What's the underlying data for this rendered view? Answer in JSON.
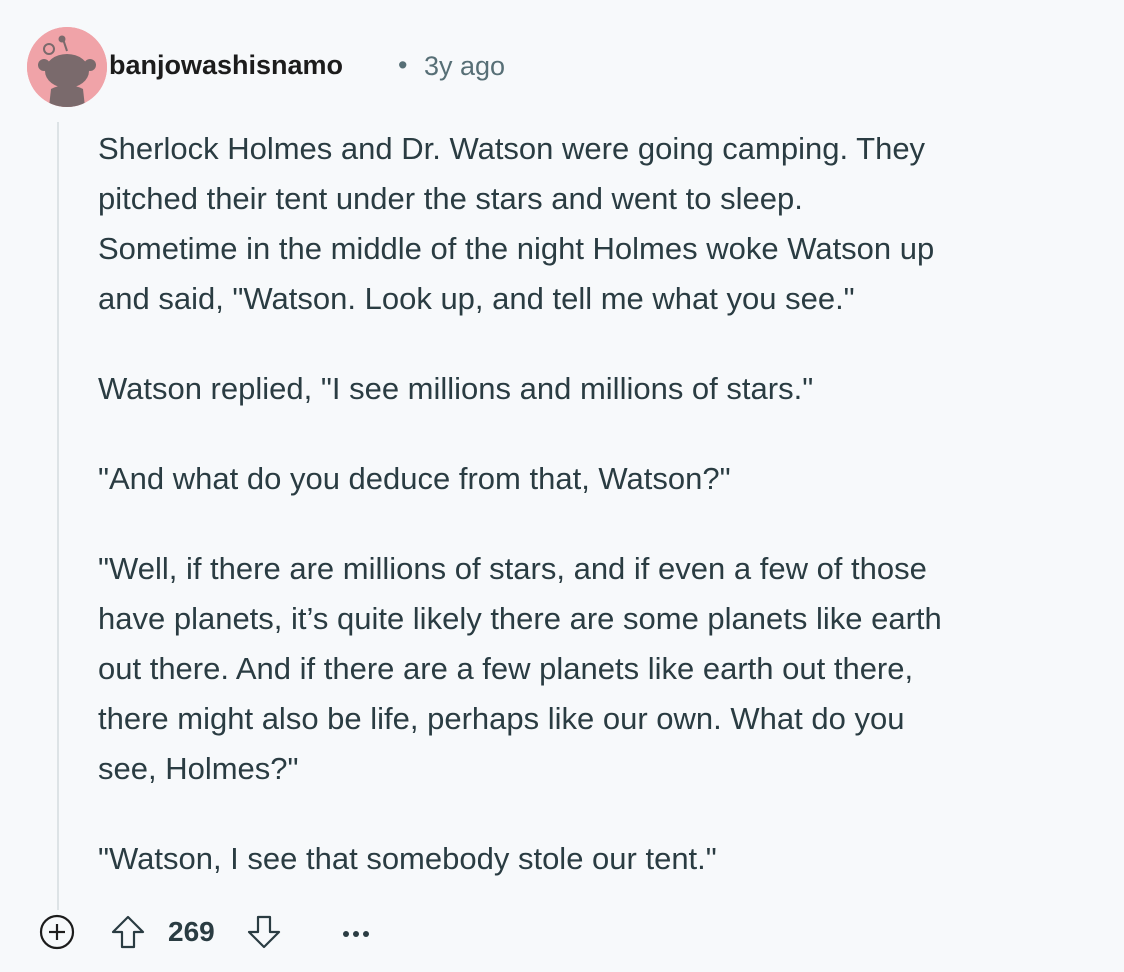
{
  "comment": {
    "author": "banjowashisnamo",
    "separator": "•",
    "age": "3y ago",
    "paragraphs": [
      "Sherlock Holmes and Dr. Watson were going camping. They\npitched their tent under the stars and went to sleep.\nSometime in the middle of the night Holmes woke Watson up\nand said, \"Watson. Look up, and tell me what you see.\"",
      "Watson replied, \"I see millions and millions of stars.\"",
      "\"And what do you deduce from that, Watson?\"",
      "\"Well, if there are millions of stars, and if even a few of those\nhave planets, it’s quite likely there are some planets like earth\nout there. And if there are a few planets like earth out there,\nthere might also be life, perhaps like our own. What do you\nsee, Holmes?\"",
      "\"Watson, I see that somebody stole our tent.\""
    ]
  },
  "actions": {
    "score": "269",
    "icons": {
      "expand": "plus-circle-icon",
      "upvote": "arrow-up-icon",
      "downvote": "arrow-down-icon",
      "more": "ellipsis-icon"
    }
  },
  "colors": {
    "avatar_bg": "#f0a3a8",
    "text": "#2a3c42",
    "meta": "#576f76",
    "thread_line": "#dde3e6",
    "background": "#f7f9fb"
  }
}
